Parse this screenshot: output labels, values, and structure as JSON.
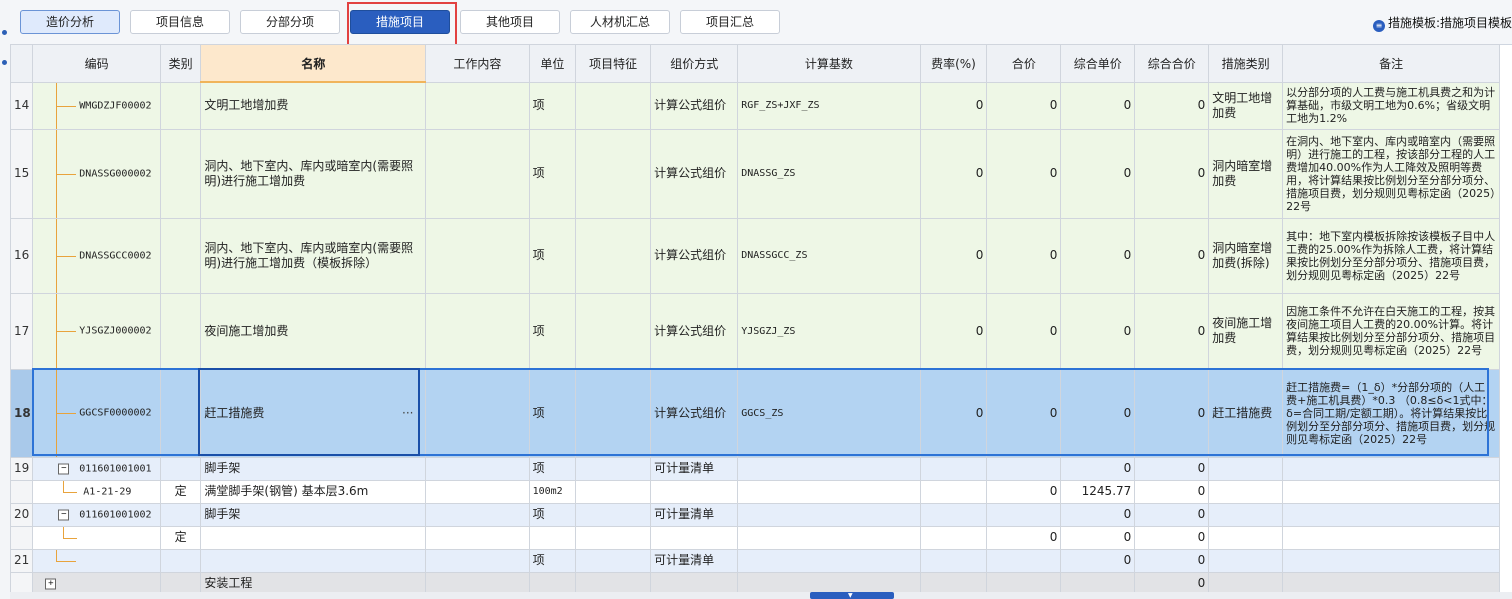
{
  "tabs": [
    {
      "label": "造价分析",
      "state": "selected"
    },
    {
      "label": "项目信息",
      "state": ""
    },
    {
      "label": "分部分项",
      "state": ""
    },
    {
      "label": "措施项目",
      "state": "active"
    },
    {
      "label": "其他项目",
      "state": ""
    },
    {
      "label": "人材机汇总",
      "state": ""
    },
    {
      "label": "项目汇总",
      "state": ""
    }
  ],
  "template_label": "措施模板:措施项目模板",
  "columns": [
    "编码",
    "类别",
    "名称",
    "工作内容",
    "单位",
    "项目特征",
    "组价方式",
    "计算基数",
    "费率(%)",
    "合价",
    "综合单价",
    "综合合价",
    "措施类别",
    "备注"
  ],
  "rows": [
    {
      "num": "14",
      "code": "WMGDZJF00002",
      "cat": "",
      "name": "文明工地增加费",
      "work": "",
      "unit": "项",
      "feat": "",
      "method": "计算公式组价",
      "basis": "RGF_ZS+JXF_ZS",
      "rate": "0",
      "hj": "0",
      "zhdj": "0",
      "zhhj": "0",
      "mtype": "文明工地增加费",
      "note": "以分部分项的人工费与施工机具费之和为计算基础，市级文明工地为0.6%；省级文明工地为1.2%"
    },
    {
      "num": "15",
      "code": "DNASSG000002",
      "cat": "",
      "name": "洞内、地下室内、库内或暗室内(需要照明)进行施工增加费",
      "work": "",
      "unit": "项",
      "feat": "",
      "method": "计算公式组价",
      "basis": "DNASSG_ZS",
      "rate": "0",
      "hj": "0",
      "zhdj": "0",
      "zhhj": "0",
      "mtype": "洞内暗室增加费",
      "note": "在洞内、地下室内、库内或暗室内（需要照明）进行施工的工程，按该部分工程的人工费增加40.00%作为人工降效及照明等费用，将计算结果按比例划分至分部分项分、措施项目费，划分规则见粤标定函（2025）22号"
    },
    {
      "num": "16",
      "code": "DNASSGCC0002",
      "cat": "",
      "name": "洞内、地下室内、库内或暗室内(需要照明)进行施工增加费（模板拆除）",
      "work": "",
      "unit": "项",
      "feat": "",
      "method": "计算公式组价",
      "basis": "DNASSGCC_ZS",
      "rate": "0",
      "hj": "0",
      "zhdj": "0",
      "zhhj": "0",
      "mtype": "洞内暗室增加费(拆除)",
      "note": "其中：地下室内模板拆除按该模板子目中人工费的25.00%作为拆除人工费，将计算结果按比例划分至分部分项分、措施项目费，划分规则见粤标定函（2025）22号"
    },
    {
      "num": "17",
      "code": "YJSGZJ000002",
      "cat": "",
      "name": "夜间施工增加费",
      "work": "",
      "unit": "项",
      "feat": "",
      "method": "计算公式组价",
      "basis": "YJSGZJ_ZS",
      "rate": "0",
      "hj": "0",
      "zhdj": "0",
      "zhhj": "0",
      "mtype": "夜间施工增加费",
      "note": "因施工条件不允许在白天施工的工程，按其夜间施工项目人工费的20.00%计算。将计算结果按比例划分至分部分项分、措施项目费，划分规则见粤标定函（2025）22号"
    },
    {
      "num": "18",
      "code": "GGCSF0000002",
      "cat": "",
      "name": "赶工措施费",
      "work": "",
      "unit": "项",
      "feat": "",
      "method": "计算公式组价",
      "basis": "GGCS_ZS",
      "rate": "0",
      "hj": "0",
      "zhdj": "0",
      "zhhj": "0",
      "mtype": "赶工措施费",
      "note": "赶工措施费=（1_δ）*分部分项的（人工费+施工机具费）*0.3 （0.8≤δ<1式中：δ=合同工期/定额工期）。将计算结果按比例划分至分部分项分、措施项目费，划分规则见粤标定函（2025）22号"
    },
    {
      "num": "19",
      "code": "011601001001",
      "cat": "",
      "name": "脚手架",
      "work": "",
      "unit": "项",
      "feat": "",
      "method": "可计量清单",
      "basis": "",
      "rate": "",
      "hj": "",
      "zhdj": "0",
      "zhhj": "0",
      "mtype": "",
      "note": ""
    },
    {
      "num": "",
      "code": "A1-21-29",
      "cat": "定",
      "name": "满堂脚手架(钢管) 基本层3.6m",
      "work": "",
      "unit": "100m2",
      "feat": "",
      "method": "",
      "basis": "",
      "rate": "",
      "hj": "0",
      "zhdj": "1245.77",
      "zhhj": "0",
      "mtype": "",
      "note": ""
    },
    {
      "num": "20",
      "code": "011601001002",
      "cat": "",
      "name": "脚手架",
      "work": "",
      "unit": "项",
      "feat": "",
      "method": "可计量清单",
      "basis": "",
      "rate": "",
      "hj": "",
      "zhdj": "0",
      "zhhj": "0",
      "mtype": "",
      "note": ""
    },
    {
      "num": "",
      "code": "",
      "cat": "定",
      "name": "",
      "work": "",
      "unit": "",
      "feat": "",
      "method": "",
      "basis": "",
      "rate": "",
      "hj": "0",
      "zhdj": "0",
      "zhhj": "0",
      "mtype": "",
      "note": ""
    },
    {
      "num": "21",
      "code": "",
      "cat": "",
      "name": "",
      "work": "",
      "unit": "项",
      "feat": "",
      "method": "可计量清单",
      "basis": "",
      "rate": "",
      "hj": "",
      "zhdj": "0",
      "zhhj": "0",
      "mtype": "",
      "note": ""
    },
    {
      "num": "",
      "code": "",
      "cat": "",
      "name": "安装工程",
      "work": "",
      "unit": "",
      "feat": "",
      "method": "",
      "basis": "",
      "rate": "",
      "hj": "",
      "zhdj": "",
      "zhhj": "0",
      "mtype": "",
      "note": ""
    }
  ],
  "colors": {
    "accent": "#2a5ebf",
    "highlight_red": "#e24141",
    "selected_row": "#b3d3f2",
    "green_row": "#eef7e6"
  },
  "icons": {
    "expand": "minus-box-icon",
    "collapse": "plus-box-icon",
    "template": "info-circle-icon",
    "more": "ellipsis-icon"
  }
}
